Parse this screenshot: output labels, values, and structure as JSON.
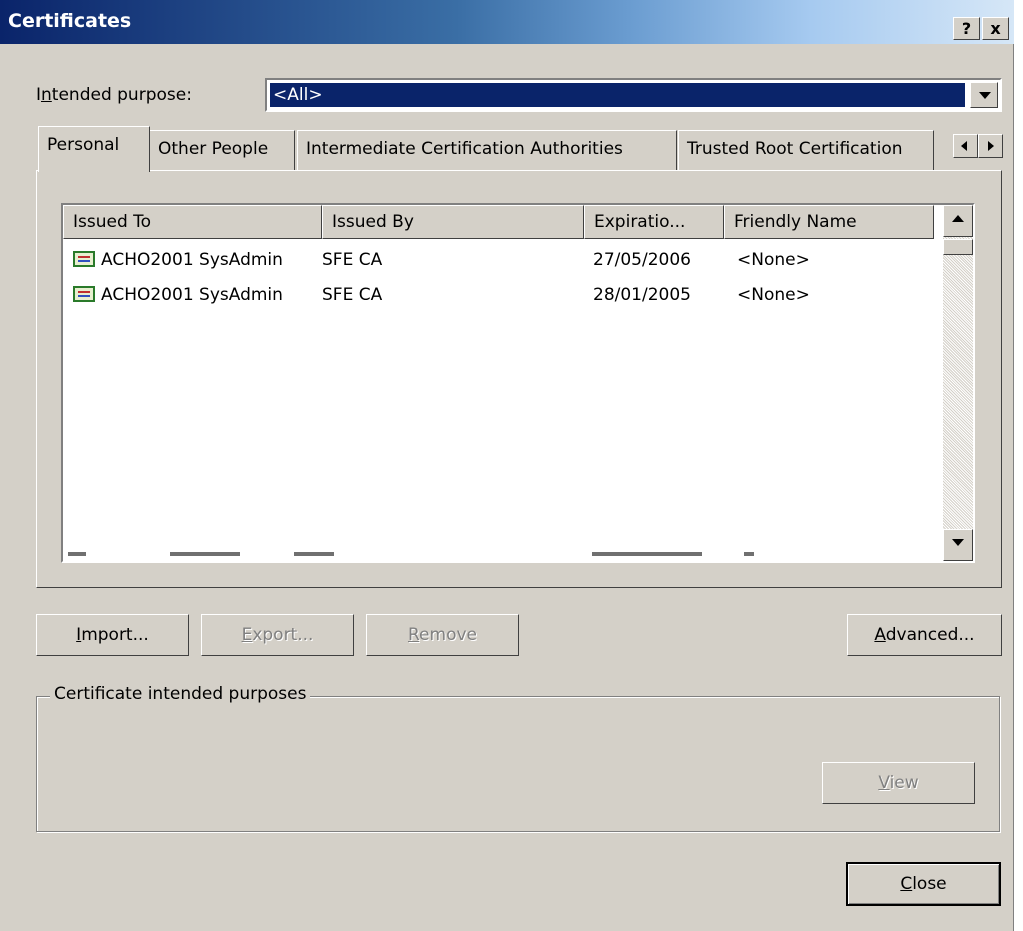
{
  "window": {
    "title": "Certificates",
    "help_label": "?",
    "close_label": "x"
  },
  "purpose": {
    "label_prefix": "I",
    "label_accel": "n",
    "label_suffix": "tended purpose:",
    "value": "<All>"
  },
  "tabs": [
    {
      "label": "Personal",
      "active": true
    },
    {
      "label": "Other People"
    },
    {
      "label": "Intermediate Certification Authorities"
    },
    {
      "label": "Trusted Root Certification"
    }
  ],
  "list": {
    "columns": [
      "Issued To",
      "Issued By",
      "Expiratio...",
      "Friendly Name"
    ],
    "rows": [
      {
        "issued_to": "ACHO2001 SysAdmin",
        "issued_by": "SFE CA",
        "expiration": "27/05/2006",
        "friendly_name": "<None>"
      },
      {
        "issued_to": "ACHO2001 SysAdmin",
        "issued_by": "SFE CA",
        "expiration": "28/01/2005",
        "friendly_name": "<None>"
      }
    ]
  },
  "buttons": {
    "import": {
      "accel": "I",
      "rest": "mport..."
    },
    "export": {
      "accel": "E",
      "rest": "xport..."
    },
    "remove": {
      "accel": "R",
      "rest": "emove"
    },
    "advanced": {
      "accel": "A",
      "rest": "dvanced..."
    },
    "view": {
      "accel": "V",
      "rest": "iew"
    },
    "close": {
      "accel": "C",
      "rest": "lose"
    }
  },
  "purposes_group": {
    "label": "Certificate intended purposes"
  },
  "colors": {
    "face": "#d4d0c8",
    "title_dark": "#0a246a",
    "selection": "#0a246a"
  }
}
